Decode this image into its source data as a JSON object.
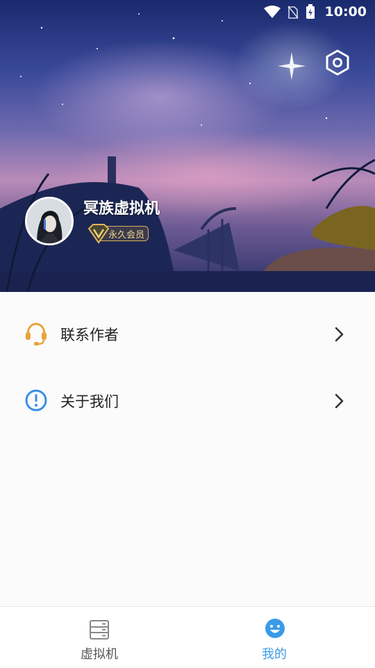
{
  "status_bar": {
    "time": "10:00",
    "icons": [
      "wifi-icon",
      "no-sim-icon",
      "battery-charging-icon"
    ]
  },
  "header": {
    "settings_icon": "settings-hexagon-icon",
    "username": "冥族虚拟机",
    "badge": {
      "label": "永久会员",
      "icon": "vip-diamond-icon",
      "color": "#d9b15a"
    }
  },
  "menu": {
    "items": [
      {
        "label": "联系作者",
        "icon": "headset-icon",
        "icon_color": "#e8a33b"
      },
      {
        "label": "关于我们",
        "icon": "info-circle-icon",
        "icon_color": "#3a8ee6"
      }
    ]
  },
  "bottom_nav": {
    "items": [
      {
        "label": "虚拟机",
        "icon": "server-stack-icon",
        "active": false
      },
      {
        "label": "我的",
        "icon": "smile-face-icon",
        "active": true
      }
    ],
    "active_color": "#3a9be8",
    "inactive_color": "#555555"
  }
}
